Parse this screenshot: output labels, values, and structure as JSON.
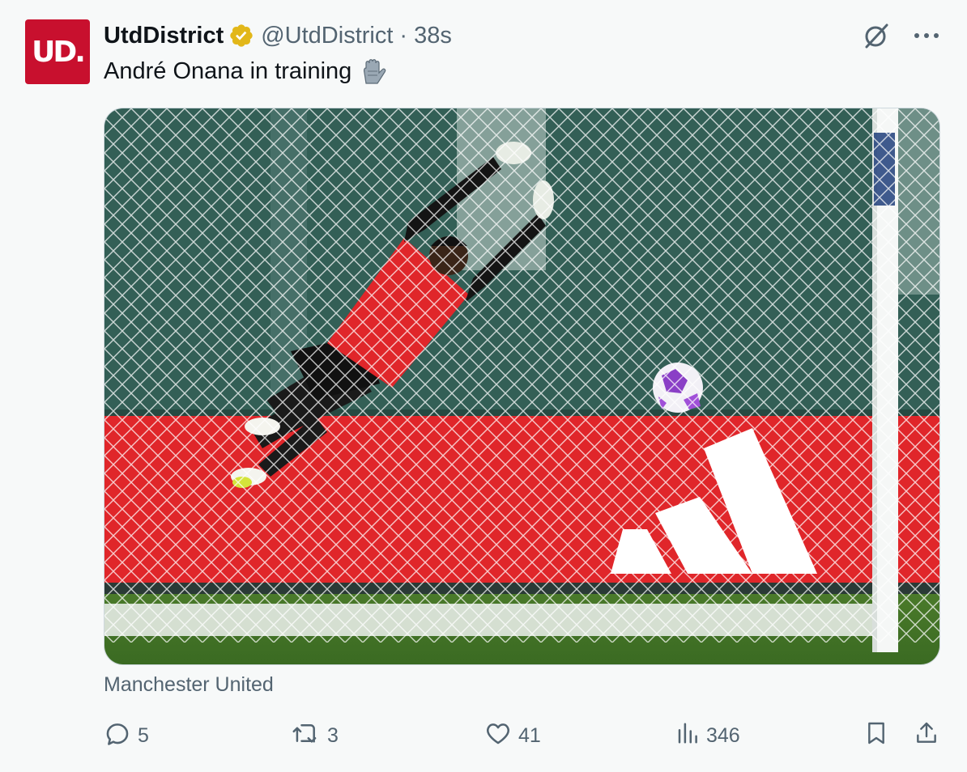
{
  "tweet": {
    "avatar_text": "UD.",
    "display_name": "UtdDistrict",
    "handle": "@UtdDistrict",
    "separator": "·",
    "time": "38s",
    "text": "André Onana in training",
    "source_label": "Manchester United"
  },
  "metrics": {
    "replies": "5",
    "reposts": "3",
    "likes": "41",
    "views": "346"
  },
  "icons": {
    "verified": "verified-badge-icon",
    "grok": "grok-icon",
    "more": "more-icon",
    "reply": "reply-icon",
    "repost": "repost-icon",
    "like": "heart-icon",
    "views": "views-icon",
    "bookmark": "bookmark-icon",
    "share": "share-icon",
    "emoji": "goalkeeper-glove-emoji"
  },
  "colors": {
    "brand": "#c8102e",
    "verified": "#e2b719",
    "text": "#0f1419",
    "secondary": "#536471"
  }
}
